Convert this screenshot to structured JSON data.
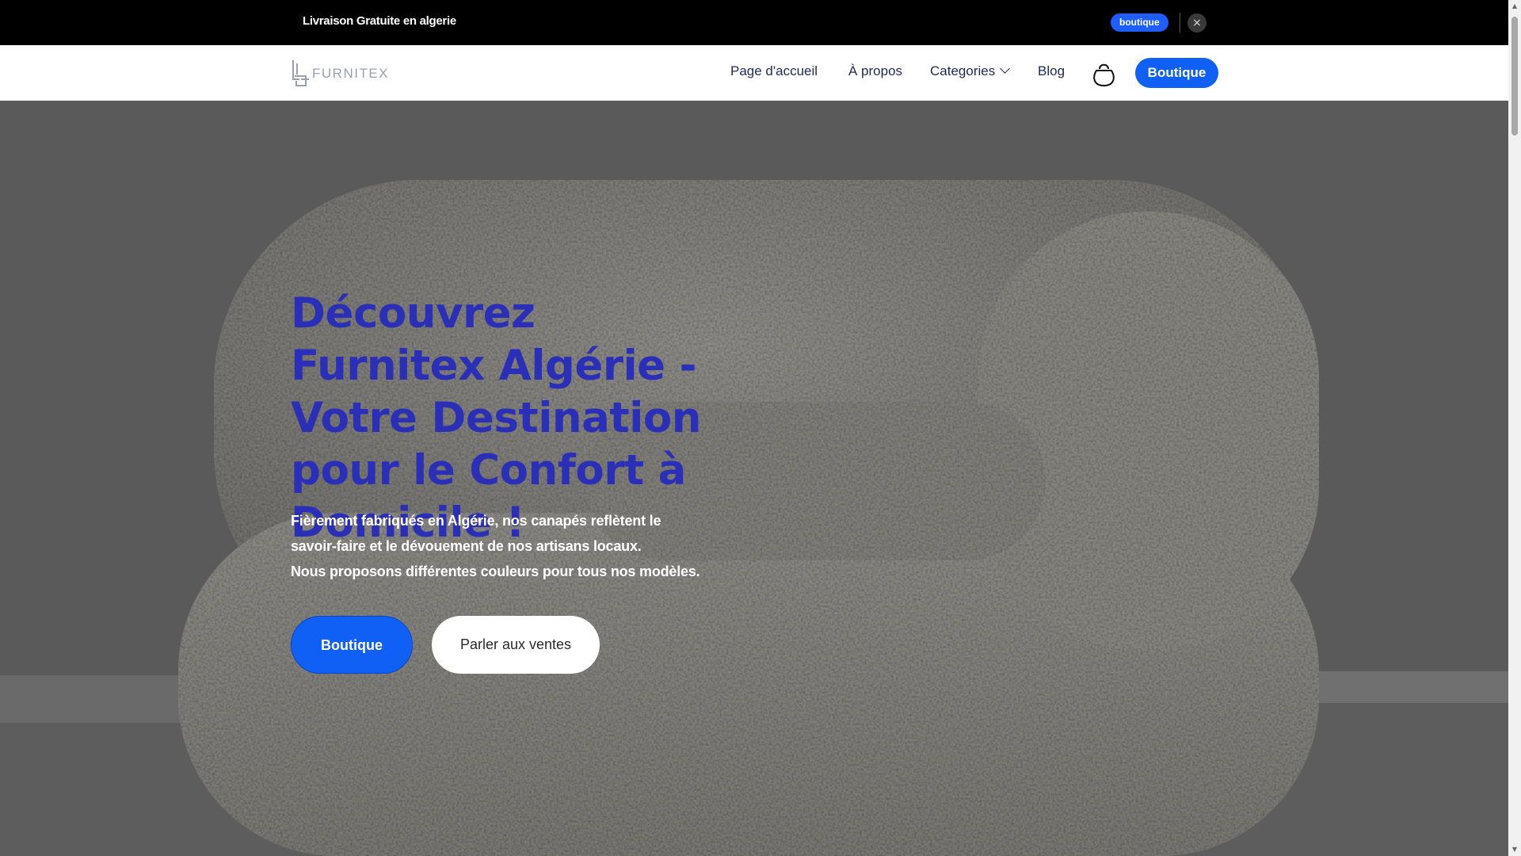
{
  "announcement": {
    "text": "Livraison Gratuite en algerie",
    "button_label": "boutique",
    "close_glyph": "×"
  },
  "header": {
    "logo_text": "FURNITEX",
    "nav": [
      {
        "label": "Page d'accueil"
      },
      {
        "label": "À propos"
      },
      {
        "label": "Categories"
      },
      {
        "label": "Blog"
      }
    ],
    "cart_icon": "shopping-bag-icon",
    "cta_label": "Boutique"
  },
  "hero": {
    "title": "Découvrez Furnitex Algérie - Votre Destination pour le Confort à Domicile !",
    "subtitle_line1": "Fièrement fabriqués en Algérie, nos canapés reflètent le",
    "subtitle_line2": "savoir-faire et le dévouement de nos artisans locaux.",
    "subtitle_line3": "Nous proposons différentes couleurs pour tous nos modèles.",
    "primary_button": "Boutique",
    "secondary_button": "Parler aux ventes"
  },
  "colors": {
    "accent": "#1160f5",
    "title": "#2b2fb8",
    "nav_text": "#1e2a5a",
    "announcement_bg": "#000000"
  }
}
